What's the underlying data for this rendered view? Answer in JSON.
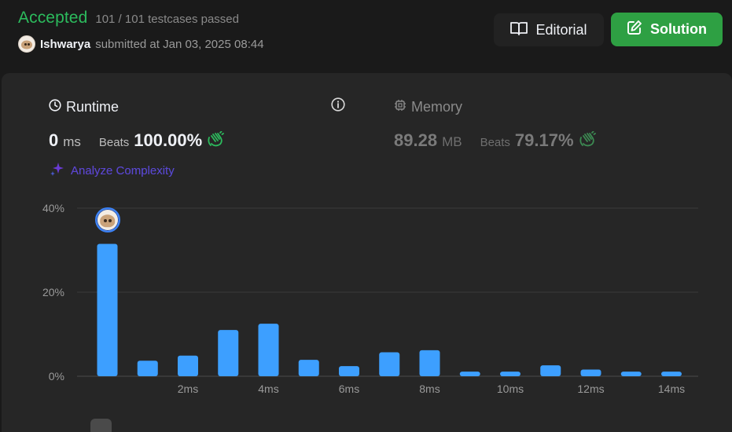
{
  "header": {
    "verdict": "Accepted",
    "testcases": "101 / 101 testcases passed",
    "user": "Ishwarya",
    "submitted_text": "submitted at Jan 03, 2025 08:44"
  },
  "actions": {
    "editorial_label": "Editorial",
    "solution_label": "Solution"
  },
  "runtime": {
    "title": "Runtime",
    "value": "0",
    "unit": "ms",
    "beats_label": "Beats",
    "beats_value": "100.00%"
  },
  "memory": {
    "title": "Memory",
    "value": "89.28",
    "unit": "MB",
    "beats_label": "Beats",
    "beats_value": "79.17%"
  },
  "analyze": {
    "label": "Analyze Complexity"
  },
  "colors": {
    "accepted": "#2cbb5d",
    "bar": "#3d9fff",
    "solution_button": "#2ea043",
    "background": "#1a1a1a",
    "panel": "#262626"
  },
  "chart_data": {
    "type": "bar",
    "x": [
      0,
      1,
      2,
      3,
      4,
      5,
      6,
      7,
      8,
      9,
      10,
      11,
      12,
      13,
      14
    ],
    "values": [
      31.5,
      3.7,
      4.9,
      11.0,
      12.5,
      3.9,
      2.4,
      5.7,
      6.2,
      1.1,
      1.1,
      2.6,
      1.6,
      1.1,
      1.1
    ],
    "y_ticks": [
      "0%",
      "20%",
      "40%"
    ],
    "y_tick_values": [
      0,
      20,
      40
    ],
    "x_tick_labels": [
      "2ms",
      "4ms",
      "6ms",
      "8ms",
      "10ms",
      "12ms",
      "14ms"
    ],
    "x_tick_values": [
      2,
      4,
      6,
      8,
      10,
      12,
      14
    ],
    "ylim": [
      0,
      40
    ],
    "grid": true,
    "highlight_index": 0
  }
}
